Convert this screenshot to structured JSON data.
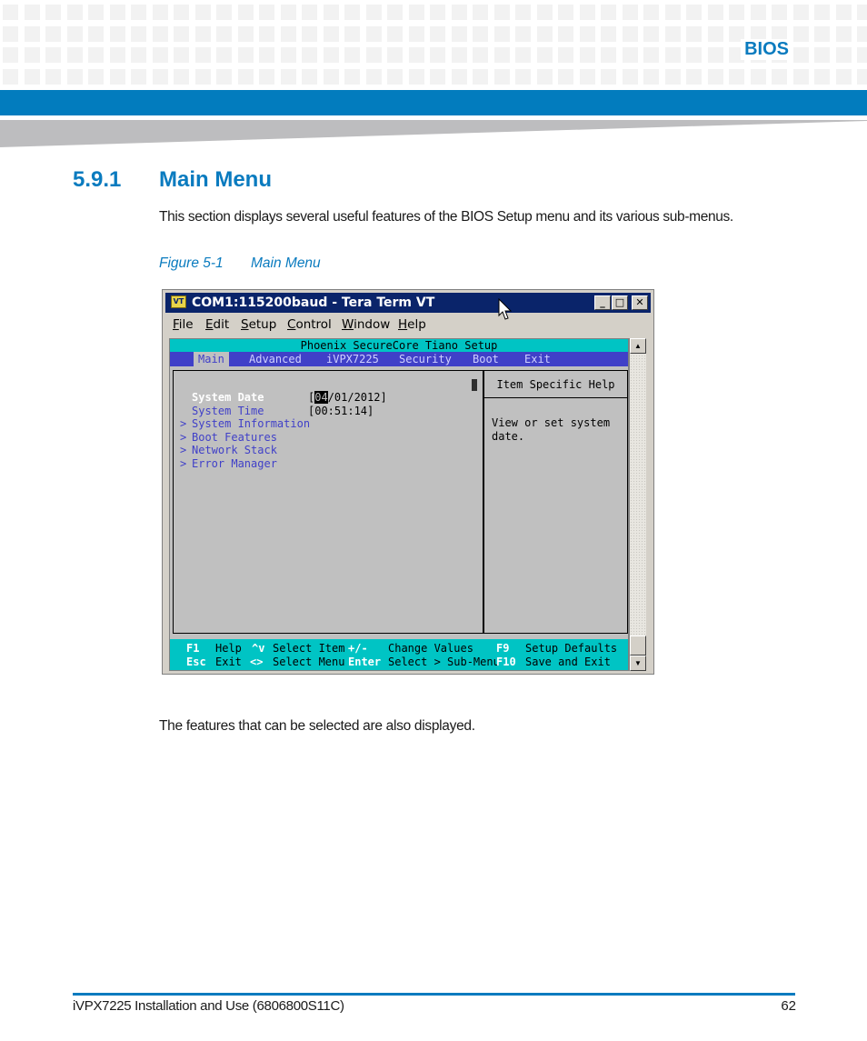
{
  "header": {
    "chapter_title": "BIOS",
    "colors": {
      "accent": "#0A7BBF",
      "bar": "#027CBE",
      "wedge": "#BDBDBF",
      "pattern": "#F2F2F2"
    }
  },
  "section": {
    "number": "5.9.1",
    "title": "Main Menu",
    "intro": "This section displays several useful features of the BIOS Setup menu and its various sub-menus.",
    "figure_label": "Figure 5-1",
    "figure_title": "Main Menu",
    "outro": "The features that can be selected are also displayed."
  },
  "window": {
    "icon_label": "VT",
    "title": "COM1:115200baud - Tera Term VT",
    "controls": {
      "minimize": "_",
      "maximize": "□",
      "close": "✕"
    },
    "menu": [
      "File",
      "Edit",
      "Setup",
      "Control",
      "Window",
      "Help"
    ],
    "bios": {
      "title": "Phoenix SecureCore Tiano Setup",
      "tabs": [
        {
          "label": "Main",
          "active": true
        },
        {
          "label": "Advanced",
          "active": false
        },
        {
          "label": "iVPX7225",
          "active": false
        },
        {
          "label": "Security",
          "active": false
        },
        {
          "label": "Boot",
          "active": false
        },
        {
          "label": "Exit",
          "active": false
        }
      ],
      "items": [
        {
          "label": "System Date",
          "value_prefix": "[",
          "value_cursor": "04",
          "value_rest": "/01/2012]",
          "selected": true,
          "submenu": false
        },
        {
          "label": "System Time",
          "value": "[00:51:14]",
          "selected": false,
          "submenu": false
        },
        {
          "label": "System Information",
          "selected": false,
          "submenu": true
        },
        {
          "label": "Boot Features",
          "selected": false,
          "submenu": true
        },
        {
          "label": "Network Stack",
          "selected": false,
          "submenu": true
        },
        {
          "label": "Error Manager",
          "selected": false,
          "submenu": true
        }
      ],
      "submenu_marker": ">",
      "help_title": "Item Specific Help",
      "help_text": "View or set system date.",
      "keys": [
        {
          "key": "F1",
          "desc": "Help"
        },
        {
          "key": "^v",
          "desc": "Select Item"
        },
        {
          "key": "+/-",
          "desc": "Change Values"
        },
        {
          "key": "F9",
          "desc": "Setup Defaults"
        },
        {
          "key": "Esc",
          "desc": "Exit"
        },
        {
          "key": "<>",
          "desc": "Select Menu"
        },
        {
          "key": "Enter",
          "desc": "Select > Sub-Menu"
        },
        {
          "key": "F10",
          "desc": "Save and Exit"
        }
      ],
      "colors": {
        "title_bg": "#00C4C4",
        "tabs_bg": "#4040C8",
        "body_bg": "#C0C0C0",
        "item_text": "#4040C8",
        "selected_text": "#FFFFFF"
      }
    }
  },
  "footer": {
    "doc_title": "iVPX7225 Installation and Use (6806800S11C)",
    "page_number": "62"
  }
}
